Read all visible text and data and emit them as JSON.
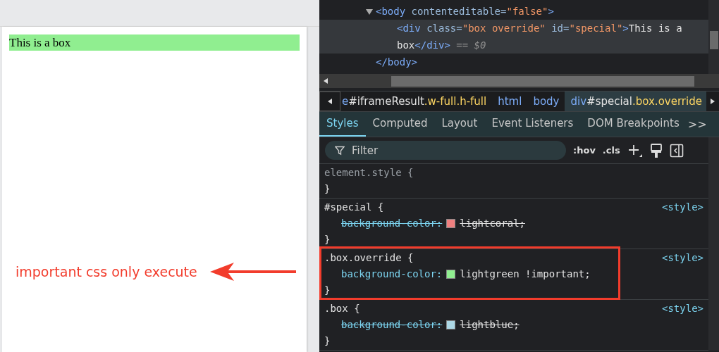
{
  "preview": {
    "box_text": "This is a box"
  },
  "annotation": {
    "text": "important css only execute"
  },
  "dom_tree": [
    {
      "expanded": true,
      "selected": false,
      "open_line": [
        {
          "kind": "tag",
          "text": "<body"
        },
        {
          "kind": "attr",
          "text": " contenteditable="
        },
        {
          "kind": "value",
          "text": "\"false\""
        },
        {
          "kind": "tag",
          "text": ">"
        }
      ],
      "children": [
        {
          "selected": true,
          "lines": [
            [
              {
                "kind": "tag",
                "text": "<div"
              },
              {
                "kind": "attr",
                "text": " class="
              },
              {
                "kind": "value",
                "text": "\"box override\""
              },
              {
                "kind": "attr",
                "text": " id="
              },
              {
                "kind": "value",
                "text": "\"special\""
              },
              {
                "kind": "tag",
                "text": ">"
              },
              {
                "kind": "text",
                "text": "This is a"
              }
            ],
            [
              {
                "kind": "text",
                "text": "box"
              },
              {
                "kind": "tag",
                "text": "</div>"
              },
              {
                "kind": "dim",
                "text": " == $0"
              }
            ]
          ]
        }
      ],
      "close_line": [
        {
          "kind": "tag",
          "text": "</body>"
        }
      ]
    }
  ],
  "breadcrumbs": [
    {
      "selected": false,
      "segments": [
        {
          "kind": "tag",
          "text": "e"
        },
        {
          "kind": "text",
          "text": "#iframeResult"
        },
        {
          "kind": "class",
          "text": ".w-full.h-full"
        }
      ]
    },
    {
      "selected": false,
      "segments": [
        {
          "kind": "tag",
          "text": "html"
        }
      ]
    },
    {
      "selected": false,
      "segments": [
        {
          "kind": "tag",
          "text": "body"
        }
      ]
    },
    {
      "selected": true,
      "segments": [
        {
          "kind": "tag",
          "text": "div"
        },
        {
          "kind": "text",
          "text": "#special"
        },
        {
          "kind": "class",
          "text": ".box.override"
        }
      ]
    }
  ],
  "tabs": [
    {
      "label": "Styles",
      "selected": true
    },
    {
      "label": "Computed",
      "selected": false
    },
    {
      "label": "Layout",
      "selected": false
    },
    {
      "label": "Event Listeners",
      "selected": false
    },
    {
      "label": "DOM Breakpoints",
      "selected": false
    }
  ],
  "more_tabs": ">>",
  "filter": {
    "placeholder": "Filter"
  },
  "toolbar": [
    ":hov",
    ".cls"
  ],
  "rules": [
    {
      "selector": "element.style {",
      "close": "}",
      "dim": true,
      "highlighted": false
    },
    {
      "selector": "#special {",
      "close": "}",
      "source": "<style>",
      "dim": false,
      "highlighted": false,
      "declarations": [
        {
          "property": "background-color:",
          "value": "lightcoral;",
          "color": "#f08080",
          "struck": true
        }
      ]
    },
    {
      "selector": ".box.override {",
      "close": "}",
      "source": "<style>",
      "dim": false,
      "highlighted": true,
      "declarations": [
        {
          "property": "background-color:",
          "value": "lightgreen !important;",
          "color": "#90ee90",
          "struck": false
        }
      ]
    },
    {
      "selector": ".box {",
      "close": "}",
      "source": "<style>",
      "dim": false,
      "highlighted": false,
      "declarations": [
        {
          "property": "background-color:",
          "value": "lightblue;",
          "color": "#add8e6",
          "struck": true
        }
      ]
    }
  ]
}
